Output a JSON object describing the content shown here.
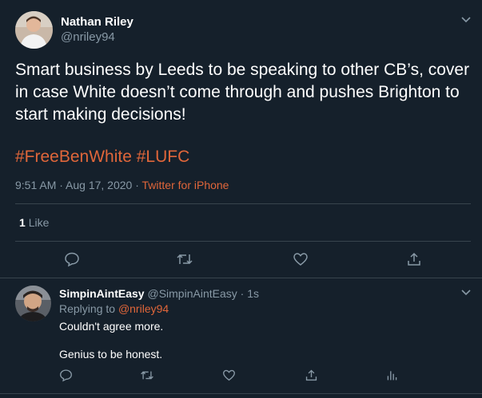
{
  "colors": {
    "background": "#15202b",
    "separator": "#38444d",
    "muted": "#8899a6",
    "accent": "#e0663a",
    "text": "#ffffff"
  },
  "main_tweet": {
    "author_name": "Nathan Riley",
    "author_handle": "@nriley94",
    "text": "Smart business by Leeds to be speaking to other CB’s, cover in case White doesn’t come through and pushes Brighton to start making decisions!",
    "hashtags": [
      "#FreeBenWhite",
      "#LUFC"
    ],
    "timestamp": "9:51 AM · Aug 17, 2020 · ",
    "source": "Twitter for iPhone",
    "likes_count": "1",
    "likes_label": "Like",
    "icons": [
      "caret-down-icon",
      "reply-icon",
      "retweet-icon",
      "like-icon",
      "share-icon"
    ]
  },
  "reply_tweet": {
    "author_name": "SimpinAintEasy",
    "author_handle": "@SimpinAintEasy",
    "time": "· 1s",
    "replying_to_label": "Replying to ",
    "replying_to_handle": "@nriley94",
    "line1": "Couldn't agree more.",
    "line2": "Genius to be honest.",
    "icons": [
      "caret-down-icon",
      "reply-icon",
      "retweet-icon",
      "like-icon",
      "share-icon",
      "analytics-icon"
    ]
  }
}
